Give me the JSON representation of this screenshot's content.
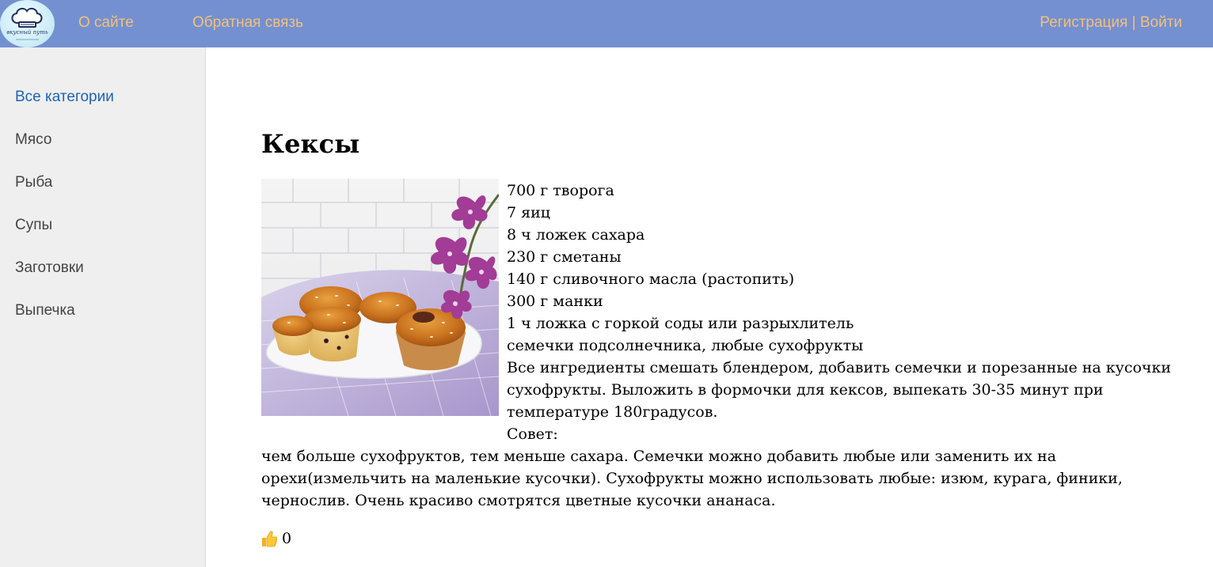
{
  "header": {
    "logo_text": "вкусный путь",
    "nav": {
      "about": "О сайте",
      "feedback": "Обратная связь"
    },
    "auth": {
      "register": "Регистрация",
      "separator": " | ",
      "login": "Войти"
    }
  },
  "sidebar": {
    "categories": [
      {
        "label": "Все категории",
        "active": true
      },
      {
        "label": "Мясо",
        "active": false
      },
      {
        "label": "Рыба",
        "active": false
      },
      {
        "label": "Супы",
        "active": false
      },
      {
        "label": "Заготовки",
        "active": false
      },
      {
        "label": "Выпечка",
        "active": false
      }
    ]
  },
  "recipe": {
    "title": "Кексы",
    "ingredients": [
      "700 г творога",
      "7 яиц",
      "8 ч ложек сахара",
      "230 г сметаны",
      "140 г сливочного масла (растопить)",
      "300 г манки",
      "1 ч ложка с горкой соды или разрыхлитель",
      "семечки подсолнечника, любые сухофрукты"
    ],
    "instructions": "Все ингредиенты смешать блендером, добавить семечки и порезанные на кусочки сухофрукты. Выложить в формочки для кексов, выпекать 30-35 минут при температуре 180градусов.",
    "tip_label": "Совет:",
    "tip_text": "чем больше сухофруктов, тем меньше сахара. Семечки можно добавить любые или заменить их на орехи(измельчить на маленькие кусочки). Сухофрукты можно использовать любые: изюм, курага, финики, чернослив. Очень красиво смотрятся цветные кусочки ананаса.",
    "likes": "0"
  },
  "icons": {
    "logo": "chef-hat-icon",
    "like": "thumbs-up-icon"
  },
  "colors": {
    "header_bg": "#7490d0",
    "header_link": "#f3c07c",
    "sidebar_bg": "#efefef",
    "active_category": "#1e63b8",
    "category_text": "#444444"
  }
}
